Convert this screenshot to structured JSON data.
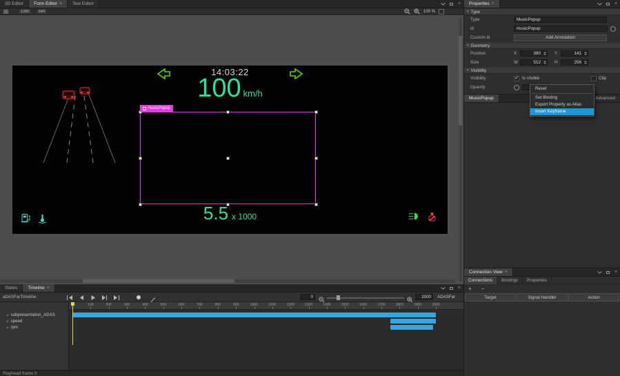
{
  "ui": {
    "close": "×"
  },
  "editor_tabs": {
    "tab_3d": "3D Editor",
    "tab_form": "Form Editor",
    "tab_text": "Text Editor"
  },
  "form_toolbar": {
    "crumb_a": "1280",
    "crumb_b": "640",
    "zoom_level": "100 %"
  },
  "hud": {
    "clock": "14:03:22",
    "speed_value": "100",
    "speed_unit": "km/h",
    "rpm_value": "5.5",
    "rpm_unit": "x 1000",
    "selection_tag": "musicPopup"
  },
  "properties": {
    "title": "Properties",
    "type_section": {
      "header": "Type",
      "type_label": "Type",
      "type_value": "MusicPopup",
      "id_label": "id",
      "id_value": "musicPopup",
      "custom_id_label": "Custom id",
      "add_annotation_label": "Add Annotation"
    },
    "geometry_section": {
      "header": "Geometry",
      "position_label": "Position",
      "x_label": "X",
      "x_value": "380",
      "y_label": "Y",
      "y_value": "141",
      "size_label": "Size",
      "w_label": "W",
      "w_value": "512",
      "h_label": "H",
      "h_value": "256"
    },
    "visibility_section": {
      "header": "Visibility",
      "visibility_label": "Visibility",
      "is_visible_label": "Is Visible",
      "is_visible_checked": "✓",
      "clip_label": "Clip",
      "opacity_label": "Opacity"
    },
    "component_tabs": [
      {
        "label": "MusicPopup"
      },
      {
        "label": "Advanced"
      }
    ]
  },
  "context_menu": {
    "reset": "Reset",
    "set_binding": "Set Binding",
    "export_alias": "Export Property as Alias",
    "insert_keyframe": "Insert Keyframe"
  },
  "connections": {
    "title": "Connection View",
    "tab_connections": "Connections",
    "tab_bindings": "Bindings",
    "tab_properties": "Properties",
    "add_label": "+",
    "remove_label": "−",
    "btn_target": "Target",
    "btn_signal_handler": "Signal Handler",
    "btn_action": "Action"
  },
  "timeline": {
    "tab_states": "States",
    "tab_timeline": "Timeline",
    "name": "aDASFarTimeline",
    "current_frame": "0",
    "end_frame": "2000",
    "active_timeline": "ADASFar",
    "ruler": {
      "start": 0,
      "end": 2000,
      "step": 100
    },
    "tracks": [
      {
        "name": "subpresentation_ADAS",
        "bars": [
          [
            0,
            2000
          ]
        ]
      },
      {
        "name": "speed",
        "bars": [
          [
            1750,
            2000
          ]
        ]
      },
      {
        "name": "rpm",
        "bars": [
          [
            1750,
            1985
          ]
        ]
      }
    ],
    "playhead_frame": 0
  },
  "status": {
    "text": "Playhead frame 0"
  }
}
